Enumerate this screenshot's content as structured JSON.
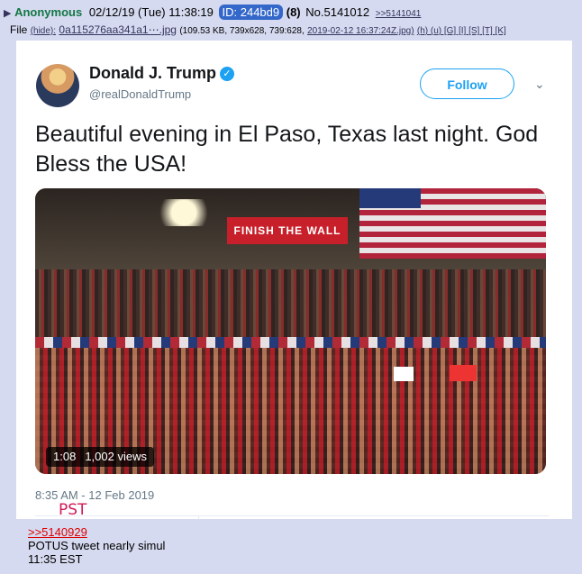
{
  "post": {
    "arrow": "▶",
    "name": "Anonymous",
    "datetime": "02/12/19 (Tue) 11:38:19",
    "id_label": "ID: 244bd9",
    "id_count": "(8)",
    "post_number": "No.5141012",
    "backlink": ">>5141041"
  },
  "file": {
    "label": "File",
    "hide": "(hide):",
    "filename": "0a115276aa341a1⋯.jpg",
    "meta": "(109.53 KB, 739x628, 739:628,",
    "date_link": "2019-02-12 16:37:24Z.jpg)",
    "links": "(h) (u) [G] [I] [S] [T] [K]"
  },
  "tweet": {
    "author": "Donald J. Trump",
    "handle": "@realDonaldTrump",
    "follow_label": "Follow",
    "text": "Beautiful evening in El Paso, Texas last night. God Bless the USA!",
    "banner_text": "FINISH THE WALL",
    "video_time": "1:08",
    "video_views": "1,002 views",
    "timestamp": "8:35 AM - 12 Feb 2019",
    "annotation": "PST",
    "colors": {
      "accent": "#1da1f2",
      "annotation": "#d11a55"
    }
  },
  "body": {
    "quote": ">>5140929",
    "lines": [
      "POTUS tweet nearly simul",
      "11:35 EST"
    ]
  }
}
